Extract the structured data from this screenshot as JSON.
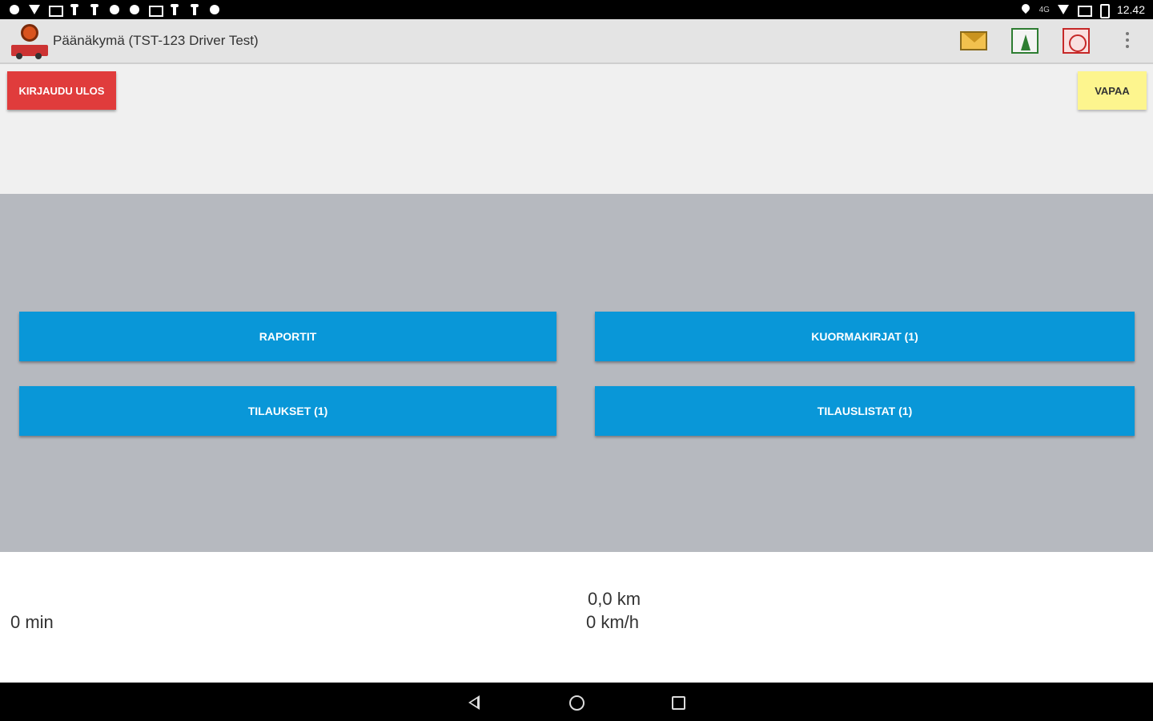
{
  "status_bar": {
    "time": "12.42",
    "network": "4G"
  },
  "action_bar": {
    "title": "Päänäkymä (TST-123 Driver Test)",
    "icons": [
      "app-logo-icon",
      "mail-icon",
      "chart-icon",
      "route-icon",
      "more-icon"
    ]
  },
  "top": {
    "logout_label": "KIRJAUDU ULOS",
    "status_label": "VAPAA"
  },
  "menu": {
    "raportit": "RAPORTIT",
    "kuormakirjat": "KUORMAKIRJAT (1)",
    "tilaukset": "TILAUKSET (1)",
    "tilauslistat": "TILAUSLISTAT (1)"
  },
  "info": {
    "time": "0 min",
    "distance": "0,0 km",
    "speed": "0 km/h"
  },
  "colors": {
    "logout": "#e03c3c",
    "status": "#fdf58e",
    "menu_button": "#0997d8",
    "panel": "#b6b9bf"
  }
}
